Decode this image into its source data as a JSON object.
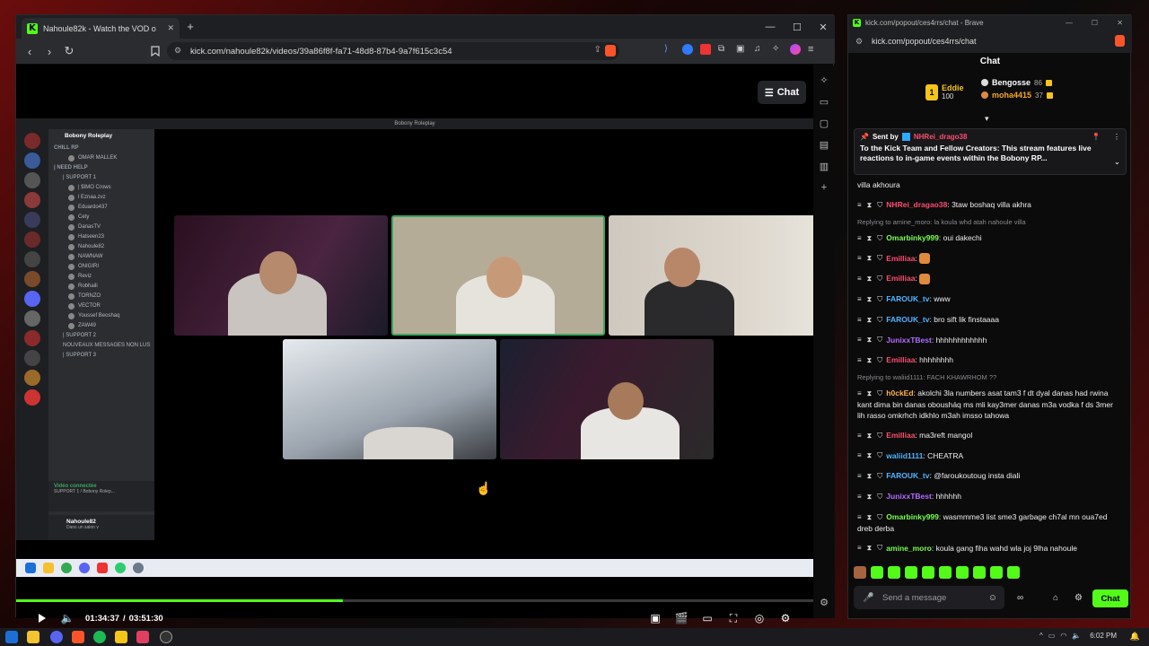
{
  "browser": {
    "tab_title": "Nahoule82k - Watch the VOD o",
    "url": "kick.com/nahoule82k/videos/39a86f8f-fa71-48d8-87b4-9a7f615c3c54",
    "chat_toggle_label": "Chat"
  },
  "discord": {
    "window_title": "Bobony Roleplay",
    "server_name": "Bobony Roleplay",
    "channels": [
      {
        "label": "CHILL RP",
        "kind": "cat"
      },
      {
        "label": "OMAR MALLEK",
        "kind": "user"
      },
      {
        "label": "| NEED HELP",
        "kind": "cat"
      },
      {
        "label": "| SUPPORT 1",
        "kind": "chan"
      },
      {
        "label": "| $IMO Crows",
        "kind": "user"
      },
      {
        "label": "l Eznaa.zvz",
        "kind": "user"
      },
      {
        "label": "Eduardo437",
        "kind": "user"
      },
      {
        "label": "Cety",
        "kind": "user"
      },
      {
        "label": "DanasTV",
        "kind": "user"
      },
      {
        "label": "Hatseen23",
        "kind": "user"
      },
      {
        "label": "Nahoule82",
        "kind": "user"
      },
      {
        "label": "NAWNAW",
        "kind": "user"
      },
      {
        "label": "ONIGIRI",
        "kind": "user"
      },
      {
        "label": "Reviz",
        "kind": "user"
      },
      {
        "label": "Robhaili",
        "kind": "user"
      },
      {
        "label": "TORNZO",
        "kind": "user"
      },
      {
        "label": "VECTOR",
        "kind": "user"
      },
      {
        "label": "Youssef Beoshaq",
        "kind": "user"
      },
      {
        "label": "ZAW49",
        "kind": "user"
      },
      {
        "label": "| SUPPORT 2",
        "kind": "chan"
      },
      {
        "label": "NOUVEAUX MESSAGES NON LUS",
        "kind": "chan"
      },
      {
        "label": "| SUPPORT 3",
        "kind": "chan"
      }
    ],
    "voice_status": "Vidéo connectée",
    "voice_channel": "SUPPORT 1 / Bobony Rolep...",
    "self_name": "Nahoule82",
    "self_status": "Dans un salon v"
  },
  "player": {
    "time_current": "01:34:37",
    "time_total": "03:51:30",
    "time_separator": "/",
    "progress_fraction": 0.41
  },
  "chat": {
    "window_title": "kick.com/popout/ces4rrs/chat - Brave",
    "url": "kick.com/popout/ces4rrs/chat",
    "header": "Chat",
    "leaderboard": [
      {
        "rank": "1",
        "name": "Eddie",
        "points": "100"
      },
      {
        "rank": "",
        "name": "Bengosse",
        "points": "86"
      },
      {
        "rank": "",
        "name": "moha4415",
        "points": "37"
      }
    ],
    "pinned": {
      "sent_by_label": "Sent by",
      "sender": "NHRei_drago38",
      "text": "To the Kick Team and Fellow Creators: This stream features live reactions to in-game events within the Bobony RP..."
    },
    "messages": [
      {
        "reply": "",
        "user": "",
        "color": "#ffffff",
        "text": "villa akhoura"
      },
      {
        "reply": "",
        "user": "NHRei_dragao38",
        "color": "#ff4d6d",
        "text": "3taw boshaq villa akhra"
      },
      {
        "reply": "Replying to amine_moro: la koula whd atah nahoule villa",
        "user": "Omarbinky999",
        "color": "#7cff4f",
        "text": "oui dakechi"
      },
      {
        "reply": "",
        "user": "Emilliaa",
        "color": "#ff4d6d",
        "text": ""
      },
      {
        "reply": "",
        "user": "Emilliaa",
        "color": "#ff4d6d",
        "text": ""
      },
      {
        "reply": "",
        "user": "FAROUK_tv",
        "color": "#4fb4ff",
        "text": "www"
      },
      {
        "reply": "",
        "user": "FAROUK_tv",
        "color": "#4fb4ff",
        "text": "bro sift lik finstaaaa"
      },
      {
        "reply": "",
        "user": "JunixxTBest",
        "color": "#b26bff",
        "text": "hhhhhhhhhhhh"
      },
      {
        "reply": "",
        "user": "Emilliaa",
        "color": "#ff4d6d",
        "text": "hhhhhhhh"
      },
      {
        "reply": "Replying to waliid1111: FACH KHAWRHOM ??",
        "user": "h0ckEd",
        "color": "#ffb347",
        "text": "akolchi 3la numbers asat tam3 f dt dyal danas had rwina kant dima bin danas obousháq ms mli kay3mer danas m3a vodka f ds 3mer lih rasso omkrhch idkhlo m3ah imsso tahowa"
      },
      {
        "reply": "",
        "user": "Emilliaa",
        "color": "#ff4d6d",
        "text": "ma3reft mangol"
      },
      {
        "reply": "",
        "user": "waliid1111",
        "color": "#4fb4ff",
        "text": "CHEATRA"
      },
      {
        "reply": "",
        "user": "FAROUK_tv",
        "color": "#4fb4ff",
        "text": "@faroukoutoug insta diali"
      },
      {
        "reply": "",
        "user": "JunixxTBest",
        "color": "#b26bff",
        "text": "hhhhhh"
      },
      {
        "reply": "",
        "user": "Omarbinky999",
        "color": "#7cff4f",
        "text": "wasmmme3 list sme3 garbage ch7al mn oua7ed dreb derba"
      },
      {
        "reply": "",
        "user": "amine_moro",
        "color": "#7cff4f",
        "text": "koula gang fiha wahd wla joj 9lha nahoule"
      }
    ],
    "input_placeholder": "Send a message",
    "send_label": "Chat"
  },
  "taskbar": {
    "time": "6:02 PM"
  },
  "colors": {
    "kick_green": "#53fc18",
    "background": "#0b0b0c"
  }
}
